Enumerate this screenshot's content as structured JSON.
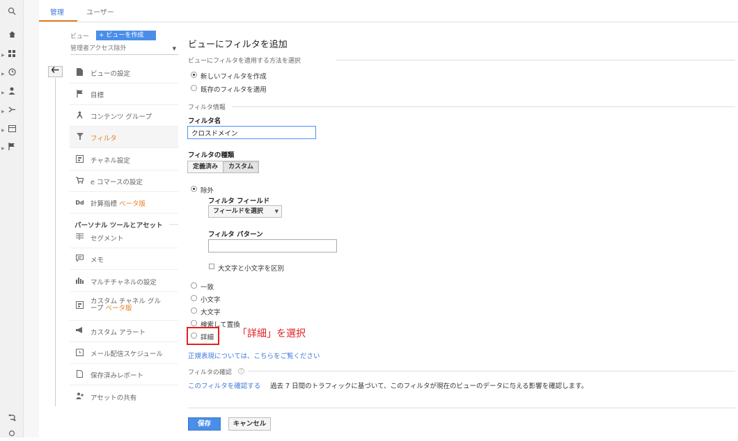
{
  "top_tabs": [
    {
      "label": "管理"
    },
    {
      "label": "ユーザー"
    }
  ],
  "sidebar": {
    "view_label": "ビュー",
    "create_view_button": "+ ビューを作成",
    "view_select": "管理者アクセス除外",
    "back_icon": "back-arrow-icon",
    "items": [
      {
        "label": "ビューの設定",
        "icon": "document-icon"
      },
      {
        "label": "目標",
        "icon": "flag-icon"
      },
      {
        "label": "コンテンツ グループ",
        "icon": "person-walk-icon"
      },
      {
        "label": "フィルタ",
        "icon": "filter-icon",
        "active": true
      },
      {
        "label": "チャネル設定",
        "icon": "channel-icon"
      },
      {
        "label": "e コマースの設定",
        "icon": "cart-icon"
      },
      {
        "label": "計算指標 ",
        "beta": "ベータ版",
        "icon": "dd-icon"
      }
    ],
    "personal_section": "パーソナル ツールとアセット",
    "personal_items": [
      {
        "label": "セグメント",
        "icon": "segment-icon"
      },
      {
        "label": "メモ",
        "icon": "memo-icon"
      },
      {
        "label": "マルチチャネルの設定",
        "icon": "bar-chart-icon"
      },
      {
        "label1": "カスタム チャネル グル",
        "label2": "ープ ",
        "beta": "ベータ版",
        "icon": "custom-channel-icon"
      },
      {
        "label": "カスタム アラート",
        "icon": "megaphone-icon"
      },
      {
        "label": "メール配信スケジュール",
        "icon": "clock-icon"
      },
      {
        "label": "保存済みレポート",
        "icon": "saved-report-icon"
      },
      {
        "label": "アセットの共有",
        "icon": "share-user-icon"
      }
    ]
  },
  "main": {
    "title": "ビューにフィルタを追加",
    "method_header": "ビューにフィルタを適用する方法を選択",
    "method_options": [
      {
        "label": "新しいフィルタを作成",
        "selected": true
      },
      {
        "label": "既存のフィルタを適用",
        "selected": false
      }
    ],
    "filter_info_header": "フィルタ情報",
    "filter_name_label": "フィルタ名",
    "filter_name_value": "クロスドメイン",
    "filter_type_label": "フィルタの種類",
    "type_buttons": [
      {
        "label": "定義済み",
        "selected": false
      },
      {
        "label": "カスタム",
        "selected": true
      }
    ],
    "exclude_label": "除外",
    "field_label": "フィルタ フィールド",
    "field_select": "フィールドを選択",
    "pattern_label": "フィルタ パターン",
    "pattern_value": "",
    "case_label": "大文字と小文字を区別",
    "other_options": [
      "一致",
      "小文字",
      "大文字",
      "検索して置換",
      "詳細"
    ],
    "callout": "「詳細」を選択",
    "regex_link": "正規表現については、こちらをご覧ください",
    "verify_header": "フィルタの確認",
    "verify_link": "このフィルタを確認する",
    "verify_text": "過去 7 日間のトラフィックに基づいて、このフィルタが現在のビューのデータに与える影響を確認します。",
    "save_button": "保存",
    "cancel_button": "キャンセル"
  },
  "colors": {
    "accent_orange": "#e67e22",
    "link_blue": "#3c78d8",
    "button_blue": "#4a8ee8",
    "callout_red": "#e02020"
  }
}
